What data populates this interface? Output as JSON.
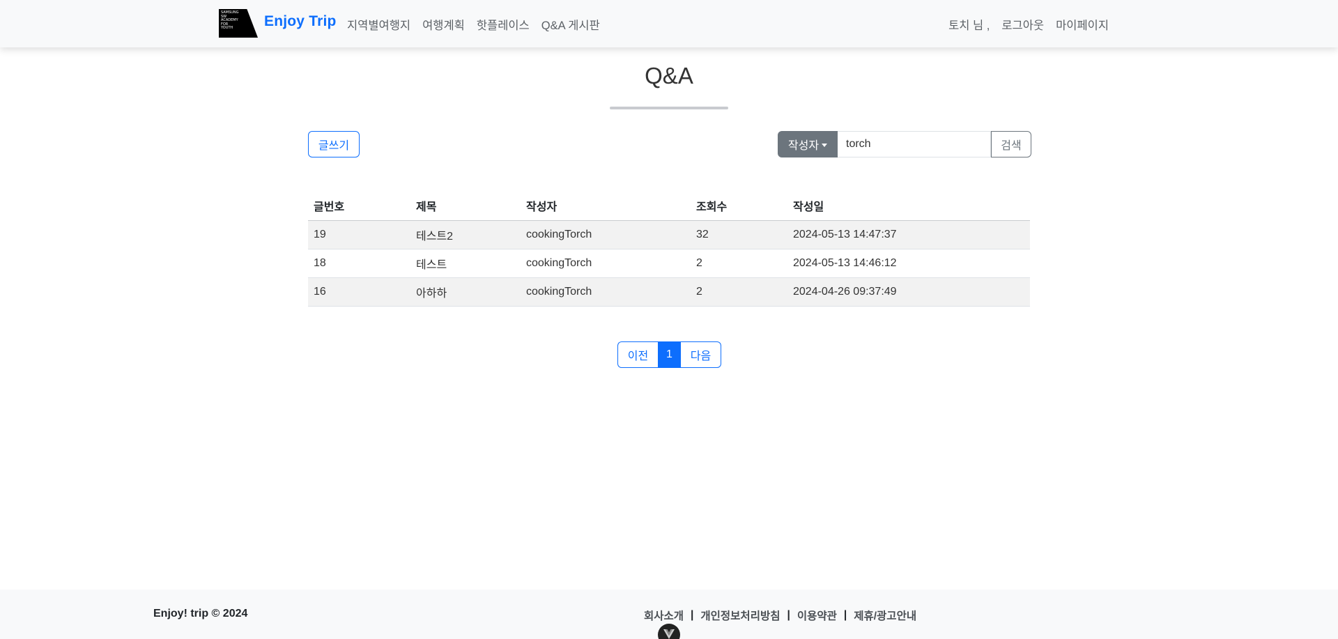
{
  "navbar": {
    "logo_lines": [
      "SAMSUNG",
      "SW",
      "ACADEMY",
      "FOR",
      "YOUTH"
    ],
    "brand": "Enjoy Trip",
    "links": [
      "지역별여행지",
      "여행계획",
      "핫플레이스",
      "Q&A 게시판"
    ],
    "user_greeting": "토치 님 ,",
    "logout": "로그아웃",
    "mypage": "마이페이지"
  },
  "page": {
    "title": "Q&A"
  },
  "controls": {
    "write_button": "글쓰기",
    "search_key": "작성자",
    "search_value": "torch",
    "search_button": "검색"
  },
  "table": {
    "headers": [
      "글번호",
      "제목",
      "작성자",
      "조회수",
      "작성일"
    ],
    "rows": [
      [
        "19",
        "테스트2",
        "cookingTorch",
        "32",
        "2024-05-13 14:47:37"
      ],
      [
        "18",
        "테스트",
        "cookingTorch",
        "2",
        "2024-05-13 14:46:12"
      ],
      [
        "16",
        "아하하",
        "cookingTorch",
        "2",
        "2024-04-26 09:37:49"
      ]
    ]
  },
  "pagination": {
    "prev": "이전",
    "current": "1",
    "next": "다음"
  },
  "footer": {
    "copyright": "Enjoy! trip © 2024",
    "links": [
      "회사소개",
      "개인정보처리방침",
      "이용약관",
      "제휴/광고안내"
    ],
    "separator": "|"
  },
  "colors": {
    "primary": "#0d6efd",
    "secondary": "#6c757d",
    "navbar_bg": "#f8f9fa"
  }
}
